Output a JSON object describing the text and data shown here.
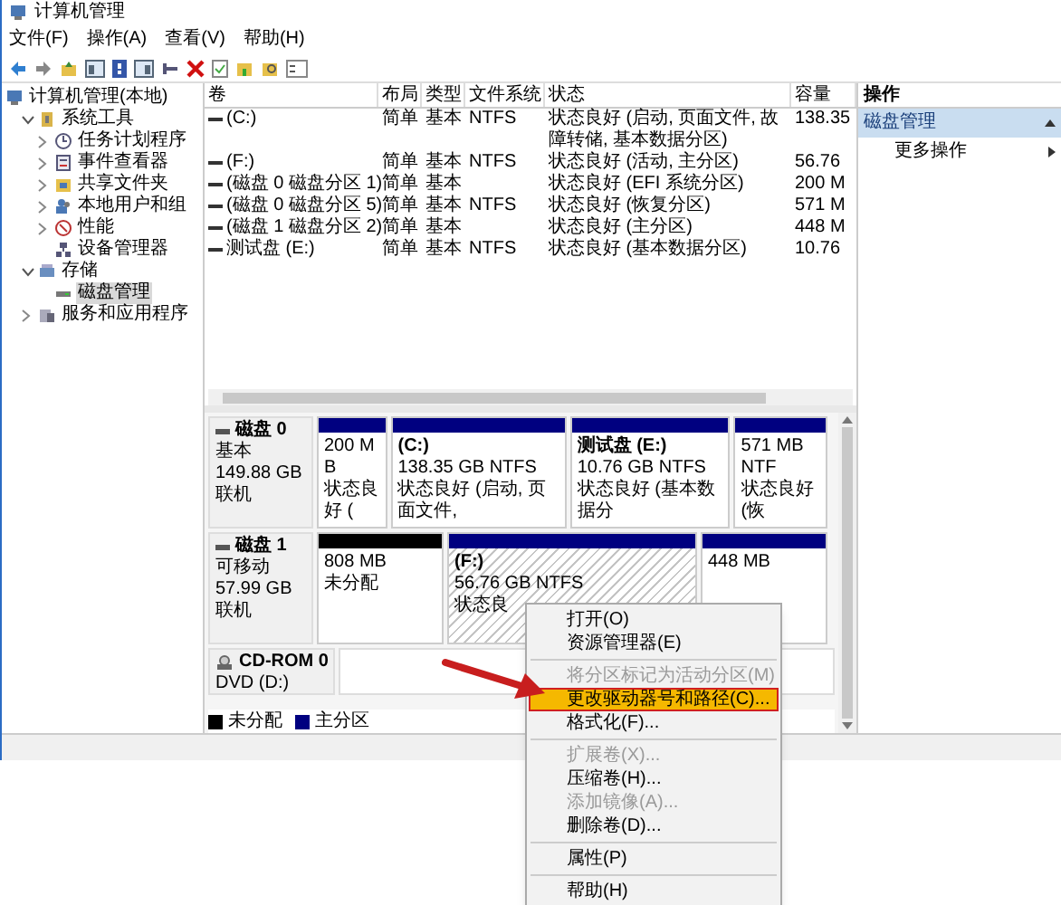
{
  "window": {
    "title": "计算机管理"
  },
  "menu_bar": [
    "文件(F)",
    "操作(A)",
    "查看(V)",
    "帮助(H)"
  ],
  "tree": [
    {
      "label": "计算机管理(本地)",
      "selected": false,
      "children": [
        {
          "label": "系统工具",
          "expanded": true,
          "selected": false,
          "children": [
            {
              "label": "任务计划程序",
              "expanded": false,
              "selected": false
            },
            {
              "label": "事件查看器",
              "expanded": false,
              "selected": false
            },
            {
              "label": "共享文件夹",
              "expanded": false,
              "selected": false
            },
            {
              "label": "本地用户和组",
              "expanded": false,
              "selected": false
            },
            {
              "label": "性能",
              "expanded": false,
              "selected": false
            },
            {
              "label": "设备管理器",
              "selected": false
            }
          ]
        },
        {
          "label": "存储",
          "expanded": true,
          "selected": false,
          "children": [
            {
              "label": "磁盘管理",
              "selected": true
            }
          ]
        },
        {
          "label": "服务和应用程序",
          "expanded": false,
          "selected": false
        }
      ]
    }
  ],
  "volumes": {
    "columns": [
      "卷",
      "布局",
      "类型",
      "文件系统",
      "状态",
      "容量"
    ],
    "rows": [
      {
        "volume": "(C:)",
        "layout": "简单",
        "type": "基本",
        "file_system": "NTFS",
        "status": "状态良好 (启动, 页面文件, 故障转储, 基本数据分区)",
        "capacity": "138.35"
      },
      {
        "volume": "(F:)",
        "layout": "简单",
        "type": "基本",
        "file_system": "NTFS",
        "status": "状态良好 (活动, 主分区)",
        "capacity": "56.76"
      },
      {
        "volume": "(磁盘 0 磁盘分区 1)",
        "layout": "简单",
        "type": "基本",
        "status": "状态良好 (EFI 系统分区)",
        "capacity": "200 M"
      },
      {
        "volume": "(磁盘 0 磁盘分区 5)",
        "layout": "简单",
        "type": "基本",
        "file_system": "NTFS",
        "status": "状态良好 (恢复分区)",
        "capacity": "571 M"
      },
      {
        "volume": "(磁盘 1 磁盘分区 2)",
        "layout": "简单",
        "type": "基本",
        "status": "状态良好 (主分区)",
        "capacity": "448 M"
      },
      {
        "volume": "测试盘 (E:)",
        "layout": "简单",
        "type": "基本",
        "file_system": "NTFS",
        "status": "状态良好 (基本数据分区)",
        "capacity": "10.76"
      }
    ]
  },
  "disks": [
    {
      "kind": "disk",
      "name": "磁盘 0",
      "lines": [
        "基本",
        "149.88 GB",
        "联机"
      ],
      "partitions": [
        {
          "kind": "primary",
          "selected": false,
          "lines": [
            "200 MB",
            "状态良好 ("
          ]
        },
        {
          "kind": "primary",
          "selected": false,
          "title": "(C:)",
          "lines": [
            "138.35 GB NTFS",
            "状态良好 (启动, 页面文件,"
          ]
        },
        {
          "kind": "primary",
          "selected": false,
          "title": "测试盘 (E:)",
          "lines": [
            "10.76 GB NTFS",
            "状态良好 (基本数据分"
          ]
        },
        {
          "kind": "primary",
          "selected": false,
          "lines": [
            "571 MB NTF",
            "状态良好 (恢"
          ]
        }
      ]
    },
    {
      "kind": "disk",
      "name": "磁盘 1",
      "lines": [
        "可移动",
        "57.99 GB",
        "联机"
      ],
      "partitions": [
        {
          "kind": "unallocated",
          "selected": false,
          "lines": [
            "808 MB",
            "未分配"
          ]
        },
        {
          "kind": "primary",
          "selected": true,
          "title": "(F:)",
          "lines": [
            "56.76 GB NTFS",
            "状态良"
          ]
        },
        {
          "kind": "primary",
          "selected": false,
          "lines": [
            "448 MB"
          ]
        }
      ]
    },
    {
      "kind": "cdrom",
      "name": "CD-ROM 0",
      "lines": [
        "DVD (D:)"
      ]
    }
  ],
  "legend": [
    {
      "label": "未分配",
      "color": "#000000"
    },
    {
      "label": "主分区",
      "color": "#000080"
    }
  ],
  "actions": {
    "title": "操作",
    "sections": [
      {
        "label": "磁盘管理",
        "expanded": true,
        "items": [
          "更多操作"
        ]
      }
    ]
  },
  "context_menu": [
    {
      "kind": "item",
      "label": "打开(O)",
      "disabled": false,
      "selected": false
    },
    {
      "kind": "item",
      "label": "资源管理器(E)",
      "disabled": false,
      "selected": false
    },
    {
      "kind": "separator"
    },
    {
      "kind": "item",
      "label": "将分区标记为活动分区(M)",
      "disabled": true,
      "selected": false
    },
    {
      "kind": "item",
      "label": "更改驱动器号和路径(C)...",
      "disabled": false,
      "selected": true
    },
    {
      "kind": "item",
      "label": "格式化(F)...",
      "disabled": false,
      "selected": false
    },
    {
      "kind": "separator"
    },
    {
      "kind": "item",
      "label": "扩展卷(X)...",
      "disabled": true,
      "selected": false
    },
    {
      "kind": "item",
      "label": "压缩卷(H)...",
      "disabled": false,
      "selected": false
    },
    {
      "kind": "item",
      "label": "添加镜像(A)...",
      "disabled": true,
      "selected": false
    },
    {
      "kind": "item",
      "label": "删除卷(D)...",
      "disabled": false,
      "selected": false
    },
    {
      "kind": "separator"
    },
    {
      "kind": "item",
      "label": "属性(P)",
      "disabled": false,
      "selected": false
    },
    {
      "kind": "separator"
    },
    {
      "kind": "item",
      "label": "帮助(H)",
      "disabled": false,
      "selected": false
    }
  ]
}
